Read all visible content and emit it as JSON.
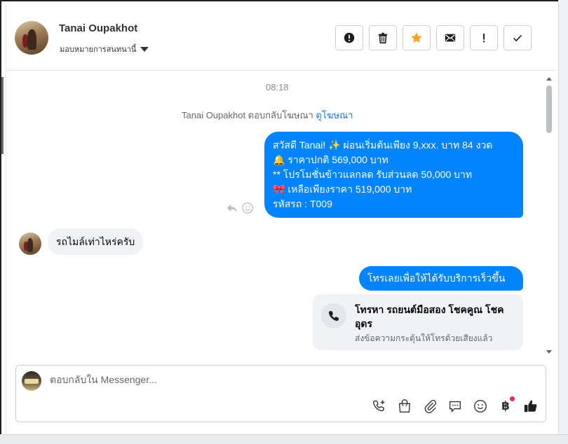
{
  "header": {
    "name": "Tanai Oupakhot",
    "assign_label": "มอบหมายการสนทนานี้",
    "actions": [
      {
        "name": "spam-button",
        "icon": "alert-circle-icon"
      },
      {
        "name": "delete-button",
        "icon": "trash-icon"
      },
      {
        "name": "star-button",
        "icon": "star-icon",
        "color": "#f5a623"
      },
      {
        "name": "mark-unread-button",
        "icon": "envelope-icon"
      },
      {
        "name": "follow-up-button",
        "icon": "exclamation-icon"
      },
      {
        "name": "done-button",
        "icon": "check-icon"
      }
    ]
  },
  "conversation": {
    "timestamp": "08:18",
    "reply_note": {
      "text": "Tanai Oupakhot ตอบกลับโฆษณา",
      "link": "ดูโฆษณา"
    },
    "outgoing_1": {
      "lines": [
        "สวัสดี Tanai! ✨  ผ่อนเริ่มต้นเพียง 9,xxx. บาท 84 งวด",
        "🔔 ราคาปกติ 569,000 บาท",
        "** โปรโมชั่นข้าวแลกลด รับส่วนลด 50,000 บาท",
        "🎀  เหลือเพียงราคา 519,000 บาท",
        " รหัสรถ : T009"
      ]
    },
    "incoming_1": "รถไมล์เท่าไหร่ครับ",
    "outgoing_2": "โทรเลยเพื่อให้ได้รับบริการเร็วขึ้น",
    "call_card": {
      "title": "โทรหา รถยนต์มือสอง โชคคูณ โชค อุดร",
      "subtitle": "ส่งข้อความกระตุ้นให้โทรด้วยเสียงแล้ว"
    }
  },
  "composer": {
    "placeholder": "ตอบกลับใน Messenger...",
    "currency_symbol": "฿",
    "accent_color": "#0084ff",
    "notification_color": "#f02849"
  }
}
